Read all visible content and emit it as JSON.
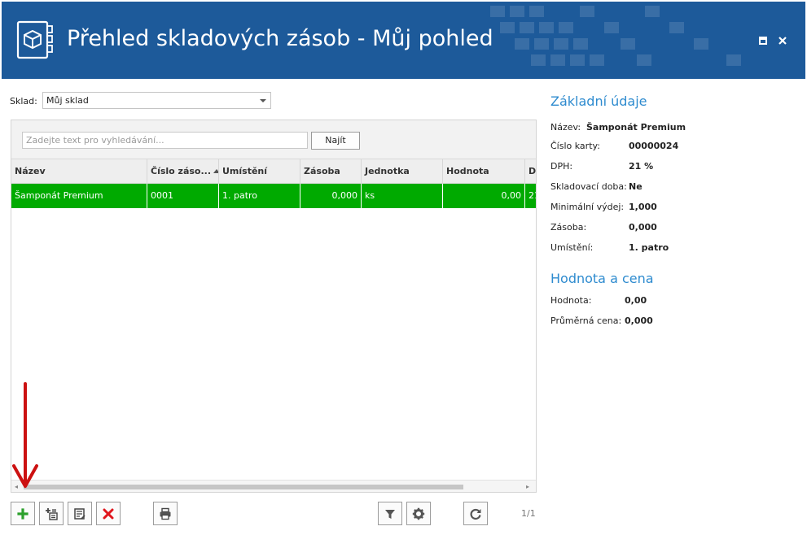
{
  "window": {
    "title": "Přehled skladových zásob - Můj pohled",
    "accent": "#1d5a9a"
  },
  "filter": {
    "sklad_label": "Sklad:",
    "sklad_value": "Můj sklad"
  },
  "search": {
    "placeholder": "Zadejte text pro vyhledávání...",
    "button_label": "Najít"
  },
  "grid": {
    "columns": [
      "Název",
      "Číslo záso...",
      "Umístění",
      "Zásoba",
      "Jednotka",
      "Hodnota",
      "D"
    ],
    "rows": [
      {
        "nazev": "Šamponát Premium",
        "cislo": "0001",
        "umisteni": "1. patro",
        "zasoba": "0,000",
        "jednotka": "ks",
        "hodnota": "0,00",
        "d": "21"
      }
    ],
    "selected_color": "#00aa00"
  },
  "toolbar": {
    "icons": [
      "add-icon",
      "add-multiple-icon",
      "edit-icon",
      "delete-icon",
      "print-icon",
      "filter-icon",
      "settings-icon",
      "refresh-icon"
    ],
    "pager": "1/1"
  },
  "details": {
    "basic_heading": "Základní údaje",
    "basic": [
      {
        "label": "Název:",
        "value": "Šamponát Premium"
      },
      {
        "label": "Číslo karty:",
        "value": "00000024"
      },
      {
        "label": "DPH:",
        "value": "21 %"
      },
      {
        "label": "Skladovací doba:",
        "value": "Ne"
      },
      {
        "label": "Minimální výdej:",
        "value": "1,000"
      },
      {
        "label": "Zásoba:",
        "value": "0,000"
      },
      {
        "label": "Umístění:",
        "value": "1. patro"
      }
    ],
    "value_heading": "Hodnota a cena",
    "value": [
      {
        "label": "Hodnota:",
        "value": "0,00"
      },
      {
        "label": "Průměrná cena:",
        "value": "0,000"
      }
    ],
    "heading_color": "#2e8bcf"
  },
  "annotation": {
    "arrow_color": "#cc1111"
  }
}
